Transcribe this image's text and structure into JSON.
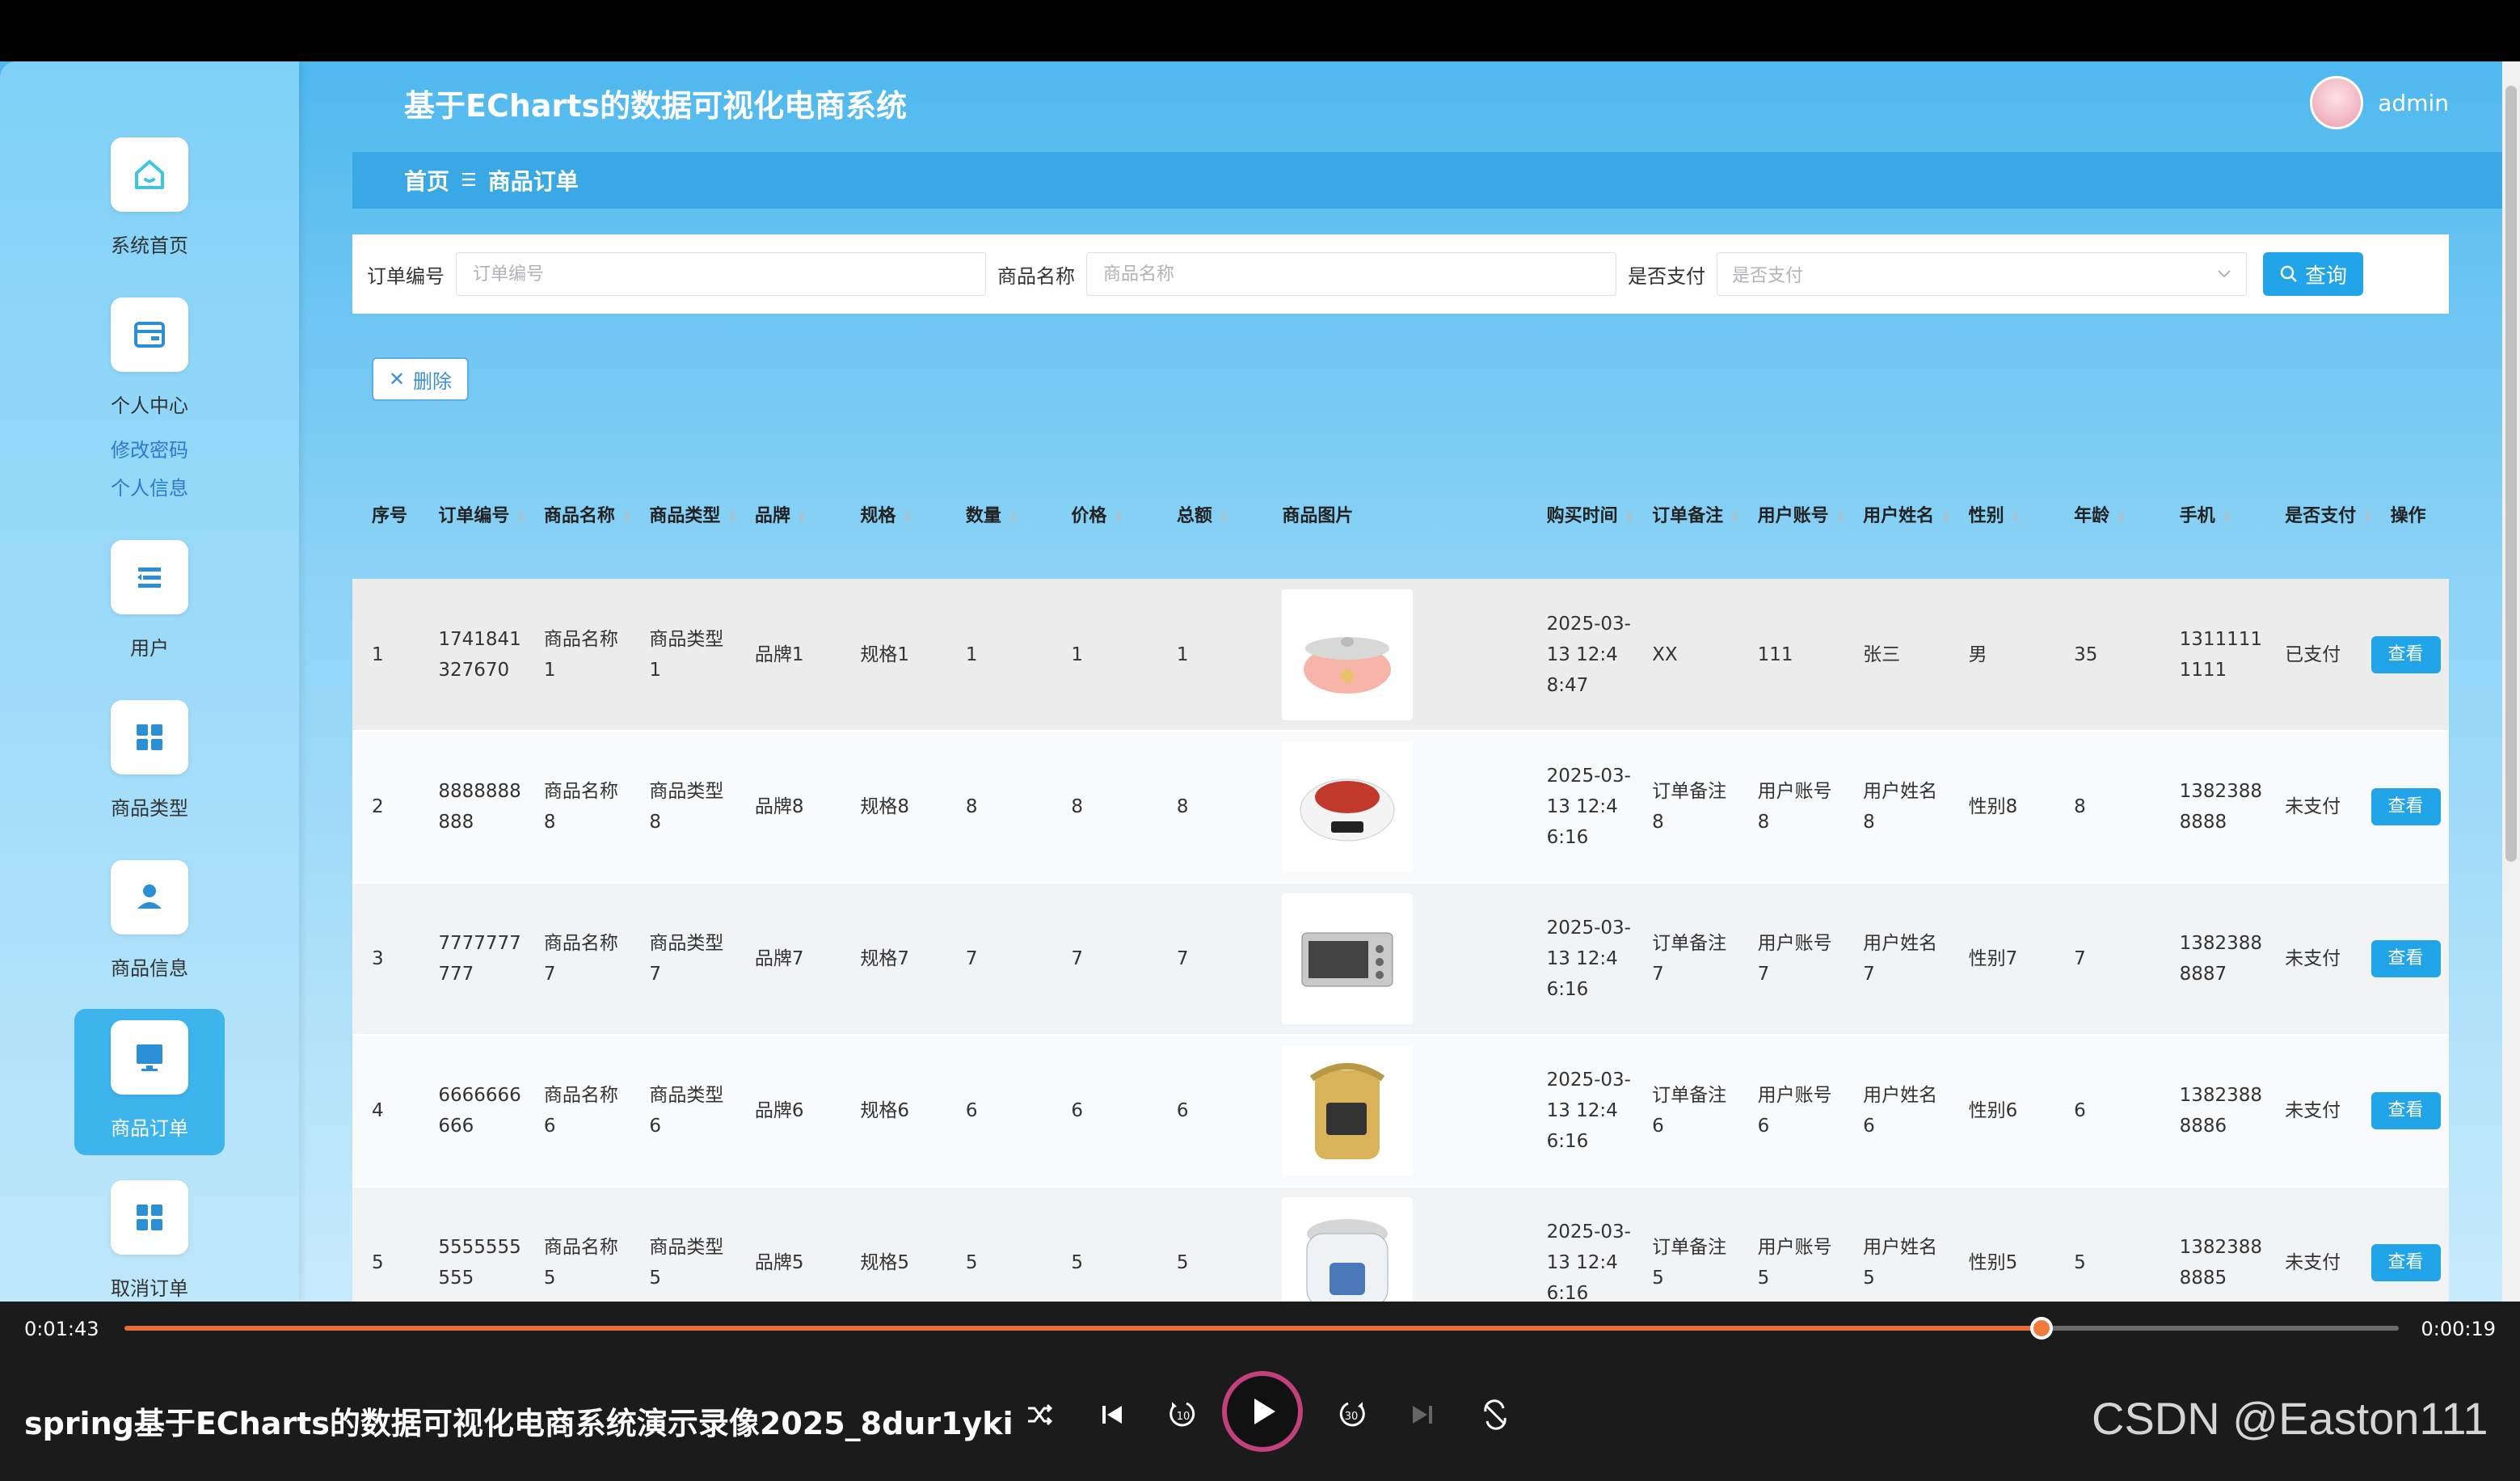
{
  "app": {
    "title": "基于ECharts的数据可视化电商系统",
    "username": "admin"
  },
  "breadcrumb": {
    "home": "首页",
    "separator": "☰",
    "current": "商品订单"
  },
  "sidebar": {
    "items": [
      {
        "label": "系统首页",
        "icon": "home-icon"
      },
      {
        "label": "个人中心",
        "icon": "wallet-icon",
        "sub": [
          "修改密码",
          "个人信息"
        ]
      },
      {
        "label": "用户",
        "icon": "menu-icon"
      },
      {
        "label": "商品类型",
        "icon": "grid-icon"
      },
      {
        "label": "商品信息",
        "icon": "person-icon"
      },
      {
        "label": "商品订单",
        "icon": "monitor-icon",
        "active": true
      },
      {
        "label": "取消订单",
        "icon": "grid-icon"
      }
    ]
  },
  "search": {
    "order_no_label": "订单编号",
    "order_no_placeholder": "订单编号",
    "product_name_label": "商品名称",
    "product_name_placeholder": "商品名称",
    "paid_label": "是否支付",
    "paid_placeholder": "是否支付",
    "button": "查询"
  },
  "toolbar": {
    "delete_label": "删除"
  },
  "table": {
    "columns": [
      "序号",
      "订单编号",
      "商品名称",
      "商品类型",
      "品牌",
      "规格",
      "数量",
      "价格",
      "总额",
      "商品图片",
      "购买时间",
      "订单备注",
      "用户账号",
      "用户姓名",
      "性别",
      "年龄",
      "手机",
      "是否支付",
      "操作"
    ],
    "rows": [
      {
        "idx": "1",
        "order_no": "1741841327670",
        "name": "商品名称1",
        "type": "商品类型1",
        "brand": "品牌1",
        "spec": "规格1",
        "qty": "1",
        "price": "1",
        "total": "1",
        "image": "pink-pot",
        "time": "2025-03-13 12:48:47",
        "note": "XX",
        "account": "111",
        "user": "张三",
        "gender": "男",
        "age": "35",
        "phone": "13111111111",
        "paid": "已支付",
        "action": "查看"
      },
      {
        "idx": "2",
        "order_no": "8888888888",
        "name": "商品名称8",
        "type": "商品类型8",
        "brand": "品牌8",
        "spec": "规格8",
        "qty": "8",
        "price": "8",
        "total": "8",
        "image": "induction-cooker",
        "time": "2025-03-13 12:46:16",
        "note": "订单备注8",
        "account": "用户账号8",
        "user": "用户姓名8",
        "gender": "性别8",
        "age": "8",
        "phone": "13823888888",
        "paid": "未支付",
        "action": "查看"
      },
      {
        "idx": "3",
        "order_no": "7777777777",
        "name": "商品名称7",
        "type": "商品类型7",
        "brand": "品牌7",
        "spec": "规格7",
        "qty": "7",
        "price": "7",
        "total": "7",
        "image": "oven",
        "time": "2025-03-13 12:46:16",
        "note": "订单备注7",
        "account": "用户账号7",
        "user": "用户姓名7",
        "gender": "性别7",
        "age": "7",
        "phone": "13823888887",
        "paid": "未支付",
        "action": "查看"
      },
      {
        "idx": "4",
        "order_no": "6666666666",
        "name": "商品名称6",
        "type": "商品类型6",
        "brand": "品牌6",
        "spec": "规格6",
        "qty": "6",
        "price": "6",
        "total": "6",
        "image": "steam-iron",
        "time": "2025-03-13 12:46:16",
        "note": "订单备注6",
        "account": "用户账号6",
        "user": "用户姓名6",
        "gender": "性别6",
        "age": "6",
        "phone": "13823888886",
        "paid": "未支付",
        "action": "查看"
      },
      {
        "idx": "5",
        "order_no": "5555555555",
        "name": "商品名称5",
        "type": "商品类型5",
        "brand": "品牌5",
        "spec": "规格5",
        "qty": "5",
        "price": "5",
        "total": "5",
        "image": "rice-cooker",
        "time": "2025-03-13 12:46:16",
        "note": "订单备注5",
        "account": "用户账号5",
        "user": "用户姓名5",
        "gender": "性别5",
        "age": "5",
        "phone": "13823888885",
        "paid": "未支付",
        "action": "查看"
      }
    ]
  },
  "player": {
    "elapsed": "0:01:43",
    "remaining": "0:00:19",
    "progress_fraction": 0.843,
    "title": "spring基于ECharts的数据可视化电商系统演示录像2025_8dur1yki",
    "watermark": "CSDN @Easton111",
    "accent": "#e86b3a"
  }
}
